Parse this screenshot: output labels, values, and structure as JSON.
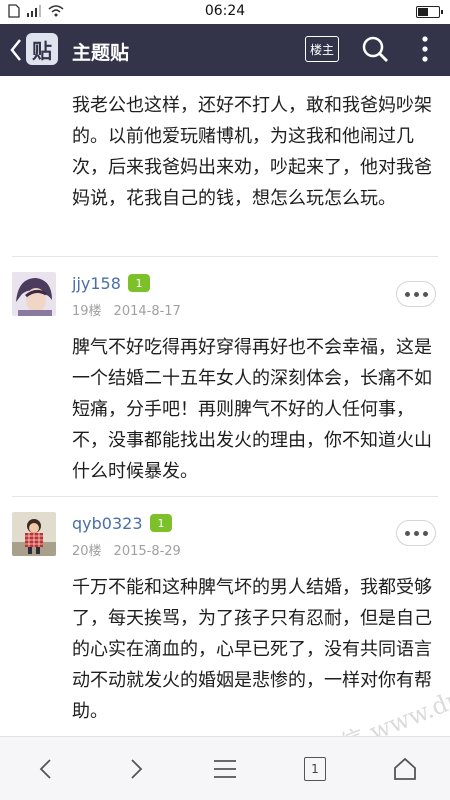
{
  "status": {
    "time": "06:24"
  },
  "navbar": {
    "logo_text": "贴",
    "title": "主题贴",
    "louzhu_label": "楼主",
    "icons": [
      "back-icon",
      "search-icon",
      "more-vertical-icon"
    ]
  },
  "posts": [
    {
      "text": "我老公也这样，还好不打人，敢和我爸妈吵架的。以前他爱玩赌博机，为这我和他闹过几次，后来我爸妈出来劝，吵起来了，他对我爸妈说，花我自己的钱，想怎么玩怎么玩。"
    },
    {
      "username": "jjy158",
      "level": "1",
      "floor": "19楼",
      "date": "2014-8-17",
      "text": "脾气不好吃得再好穿得再好也不会幸福，这是一个结婚二十五年女人的深刻体会，长痛不如短痛，分手吧！再则脾气不好的人任何事，不，没事都能找出发火的理由，你不知道火山什么时候暴发。"
    },
    {
      "username": "qyb0323",
      "level": "1",
      "floor": "20楼",
      "date": "2015-8-29",
      "text": "千万不能和这种脾气坏的男人结婚，我都受够了，每天挨骂，为了孩子只有忍耐，但是自己的心实在滴血的，心早已死了，没有共同语言动不动就发火的婚姻是悲惨的，一样对你有帮助。"
    }
  ],
  "watermark": "赌 百 稻 信 www.duchang.org",
  "bottombar": {
    "page": "1",
    "icons": [
      "back-arrow-icon",
      "forward-arrow-icon",
      "menu-icon",
      "page-icon",
      "home-icon"
    ]
  }
}
